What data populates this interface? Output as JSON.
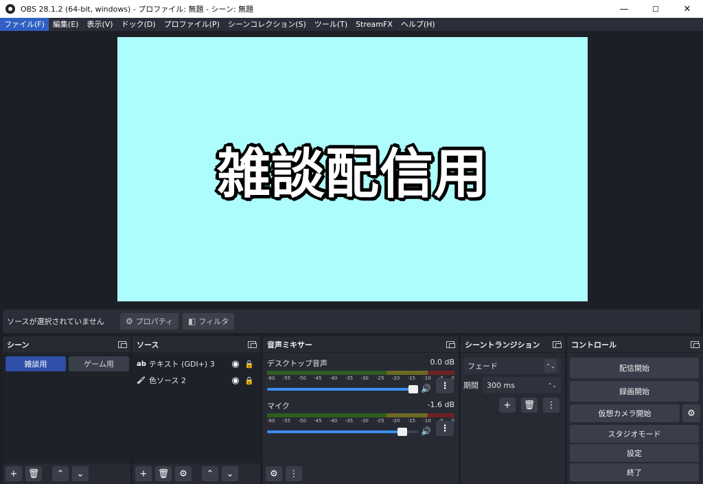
{
  "window": {
    "title": "OBS 28.1.2 (64-bit, windows) - プロファイル: 無題 - シーン: 無題",
    "min": "—",
    "max": "☐",
    "close": "✕"
  },
  "menu": [
    "ファイル(F)",
    "編集(E)",
    "表示(V)",
    "ドック(D)",
    "プロファイル(P)",
    "シーンコレクション(S)",
    "ツール(T)",
    "StreamFX",
    "ヘルプ(H)"
  ],
  "preview": {
    "text": "雑談配信用",
    "bg": "#aefdfd"
  },
  "sourcebar": {
    "message": "ソースが選択されていません",
    "properties": "プロパティ",
    "filters": "フィルタ"
  },
  "scenes": {
    "title": "シーン",
    "items": [
      "雑談用",
      "ゲーム用"
    ]
  },
  "sources": {
    "title": "ソース",
    "items": [
      {
        "icon": "ab",
        "name": "テキスト (GDI+) 3"
      },
      {
        "icon": "brush",
        "name": "色ソース 2"
      }
    ]
  },
  "mixer": {
    "title": "音声ミキサー",
    "ticks": [
      "-60",
      "-55",
      "-50",
      "-45",
      "-40",
      "-35",
      "-30",
      "-25",
      "-20",
      "-15",
      "-10",
      "-5",
      "0"
    ],
    "channels": [
      {
        "name": "デスクトップ音声",
        "db": "0.0 dB",
        "volume": 1.0
      },
      {
        "name": "マイク",
        "db": "-1.6 dB",
        "volume": 0.92
      }
    ]
  },
  "transitions": {
    "title": "シーントランジション",
    "type": "フェード",
    "duration_label": "期間",
    "duration": "300 ms"
  },
  "controls": {
    "title": "コントロール",
    "start_stream": "配信開始",
    "start_record": "録画開始",
    "virtual_cam": "仮想カメラ開始",
    "studio_mode": "スタジオモード",
    "settings": "設定",
    "exit": "終了"
  }
}
